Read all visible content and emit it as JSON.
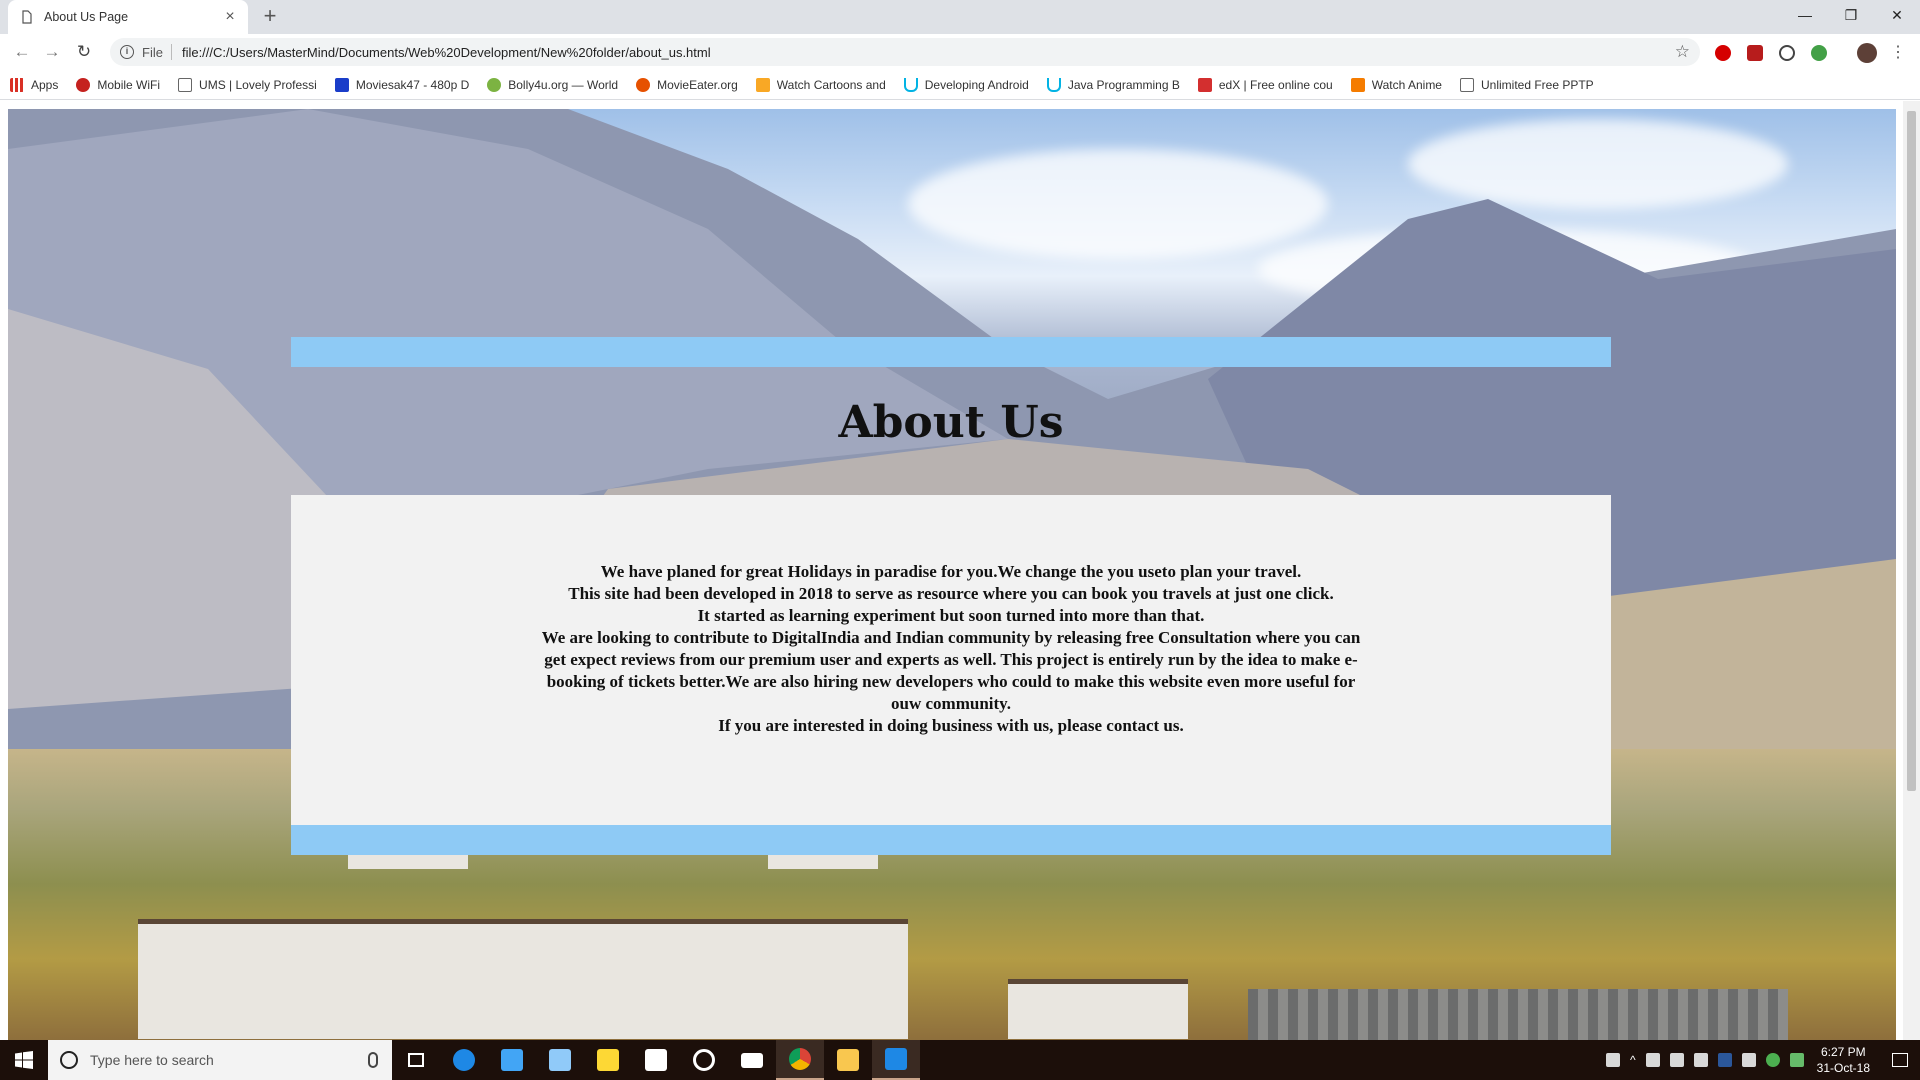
{
  "browser": {
    "tab_title": "About Us Page",
    "tab_close": "×",
    "new_tab": "+",
    "url_scheme": "File",
    "url": "file:///C:/Users/MasterMind/Documents/Web%20Development/New%20folder/about_us.html",
    "window_controls": {
      "minimize": "—",
      "restore": "❐",
      "close": "✕"
    },
    "bookmarks": [
      {
        "label": "Apps",
        "icon": "apps-grid-icon",
        "color": "#d93025"
      },
      {
        "label": "Mobile WiFi",
        "icon": "mobile-wifi-icon",
        "color": "#c5221f"
      },
      {
        "label": "UMS | Lovely Professi",
        "icon": "page-icon",
        "color": "#ffffff"
      },
      {
        "label": "Moviesak47 - 480p D",
        "icon": "moviesak-icon",
        "color": "#1a3dc9"
      },
      {
        "label": "Bolly4u.org — World",
        "icon": "bolly4u-icon",
        "color": "#7cb342"
      },
      {
        "label": "MovieEater.org",
        "icon": "movieeater-icon",
        "color": "#e65100"
      },
      {
        "label": "Watch Cartoons and",
        "icon": "cartoons-icon",
        "color": "#f9a825"
      },
      {
        "label": "Developing Android",
        "icon": "udacity-icon",
        "color": "#02b3e4"
      },
      {
        "label": "Java Programming B",
        "icon": "udacity-icon",
        "color": "#02b3e4"
      },
      {
        "label": "edX | Free online cou",
        "icon": "edx-icon",
        "color": "#d32f2f"
      },
      {
        "label": "Watch Anime",
        "icon": "anime-icon",
        "color": "#f57c00"
      },
      {
        "label": "Unlimited Free PPTP",
        "icon": "page-icon",
        "color": "#ffffff"
      }
    ]
  },
  "page": {
    "heading": "About Us",
    "paragraph_lines": [
      "We have planed for great Holidays in paradise for you.We change the you useto plan your travel.",
      "This site had been developed in 2018 to serve as resource where you can book you travels at just one click.",
      "It started as learning experiment but soon turned into more than that.",
      "We are looking to contribute to DigitalIndia and Indian community by releasing free Consultation where you can get expect reviews from our premium user and experts as well. This project is entirely run by the idea to make e-booking of tickets better.We are also hiring new developers who could to make this website even more useful for ouw community.",
      "If you are interested in doing business with us, please contact us."
    ],
    "accent_band_color": "#8ecaf5",
    "panel_color": "#f2f2f2"
  },
  "taskbar": {
    "search_placeholder": "Type here to search",
    "time": "6:27 PM",
    "date": "31-Oct-18",
    "apps": [
      "task-view-icon",
      "edge-icon",
      "store-icon",
      "network-icon",
      "sticky-notes-icon",
      "shopping-bag-icon",
      "groove-icon",
      "mail-icon",
      "chrome-icon",
      "file-explorer-icon",
      "vscode-icon"
    ]
  }
}
